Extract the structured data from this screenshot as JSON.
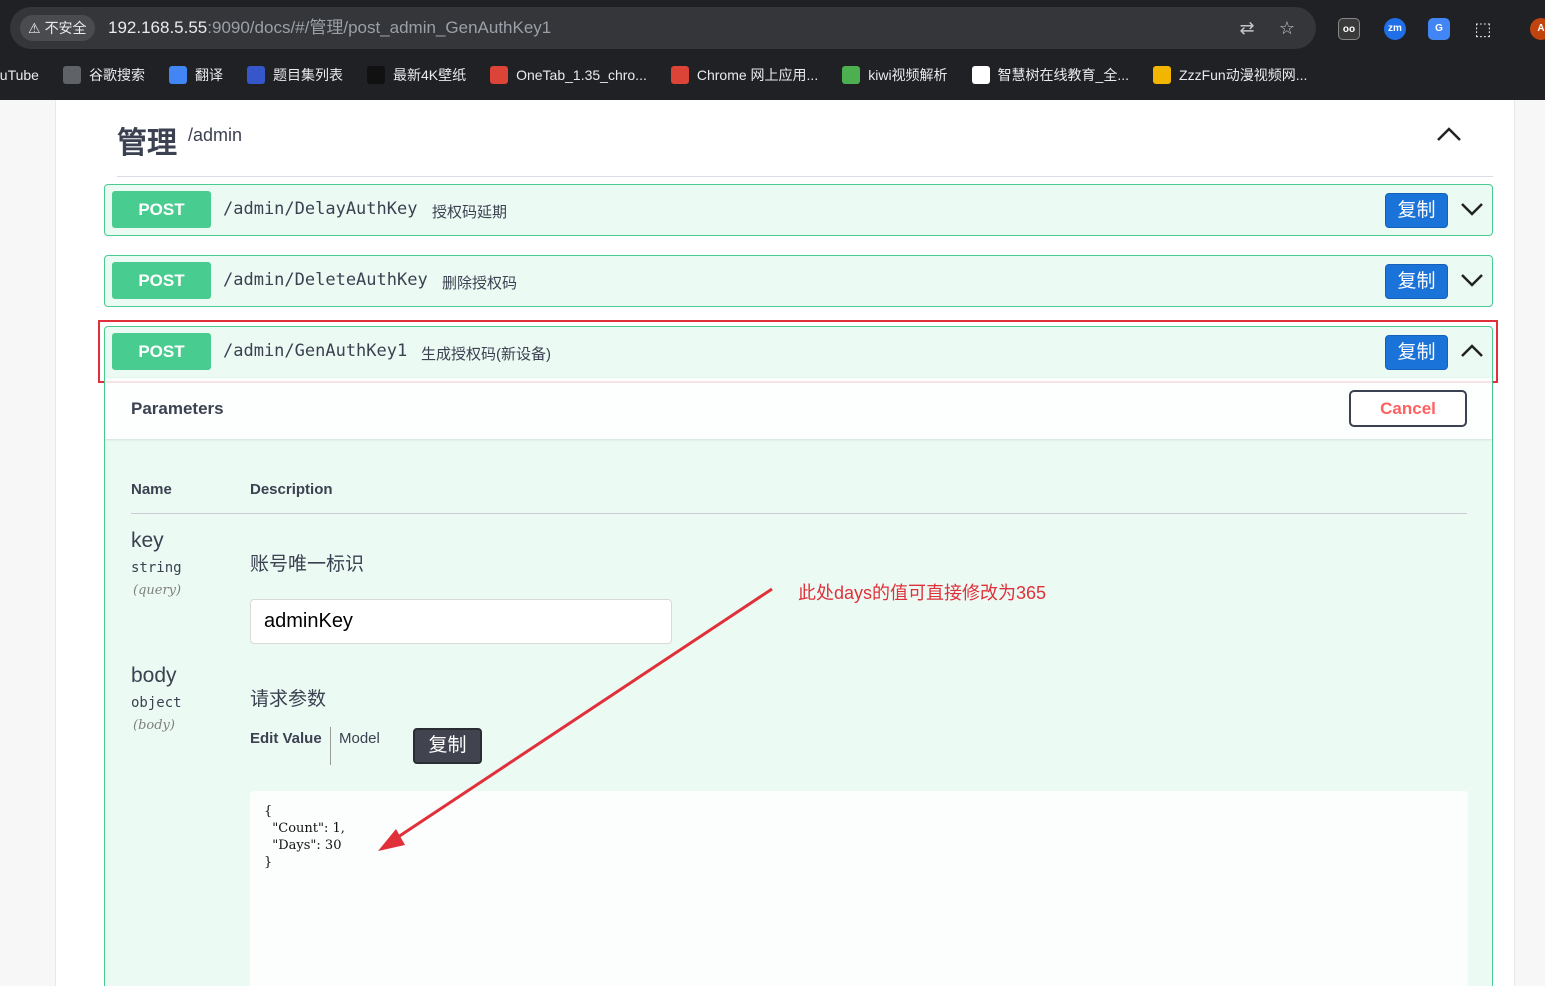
{
  "browser": {
    "insecure_label": "不安全",
    "url_host": "192.168.5.55",
    "url_rest": ":9090/docs/#/管理/post_admin_GenAuthKey1",
    "bookmarks": [
      {
        "label": "ouTube",
        "icon": "youtube-icon",
        "color": "#202124"
      },
      {
        "label": "谷歌搜索",
        "icon": "globe-icon",
        "color": "#5f6368"
      },
      {
        "label": "翻译",
        "icon": "translate-icon",
        "color": "#4285f4"
      },
      {
        "label": "题目集列表",
        "icon": "list-icon",
        "color": "#3557c9"
      },
      {
        "label": "最新4K壁纸",
        "icon": "4k-icon",
        "color": "#111111"
      },
      {
        "label": "OneTab_1.35_chro...",
        "icon": "chrome-icon",
        "color": "#db4437"
      },
      {
        "label": "Chrome 网上应用...",
        "icon": "webstore-icon",
        "color": "#db4437"
      },
      {
        "label": "kiwi视频解析",
        "icon": "kiwi-icon",
        "color": "#4caf50"
      },
      {
        "label": "智慧树在线教育_全...",
        "icon": "zhihuishu-icon",
        "color": "#ffffff"
      },
      {
        "label": "ZzzFun动漫视频网...",
        "icon": "rss-icon",
        "color": "#f2b600"
      }
    ]
  },
  "tag": {
    "title": "管理",
    "path": "/admin"
  },
  "operations": [
    {
      "method": "POST",
      "path": "/admin/DelayAuthKey",
      "summary": "授权码延期",
      "copy_label": "复制"
    },
    {
      "method": "POST",
      "path": "/admin/DeleteAuthKey",
      "summary": "删除授权码",
      "copy_label": "复制"
    },
    {
      "method": "POST",
      "path": "/admin/GenAuthKey1",
      "summary": "生成授权码(新设备)",
      "copy_label": "复制"
    }
  ],
  "params": {
    "title": "Parameters",
    "cancel_label": "Cancel",
    "col_name": "Name",
    "col_desc": "Description",
    "key": {
      "name": "key",
      "type": "string",
      "in": "(query)",
      "desc": "账号唯一标识",
      "value": "adminKey"
    },
    "body": {
      "name": "body",
      "type": "object",
      "in": "(body)",
      "desc": "请求参数",
      "tab_edit": "Edit Value",
      "tab_model": "Model",
      "copy_label": "复制",
      "json": "{\n  \"Count\": 1,\n  \"Days\": 30\n}"
    }
  },
  "annotation": "此处days的值可直接修改为365",
  "colors": {
    "post": "#49cc90",
    "copy_button": "#1a73d9",
    "annotation": "#e0313b"
  }
}
